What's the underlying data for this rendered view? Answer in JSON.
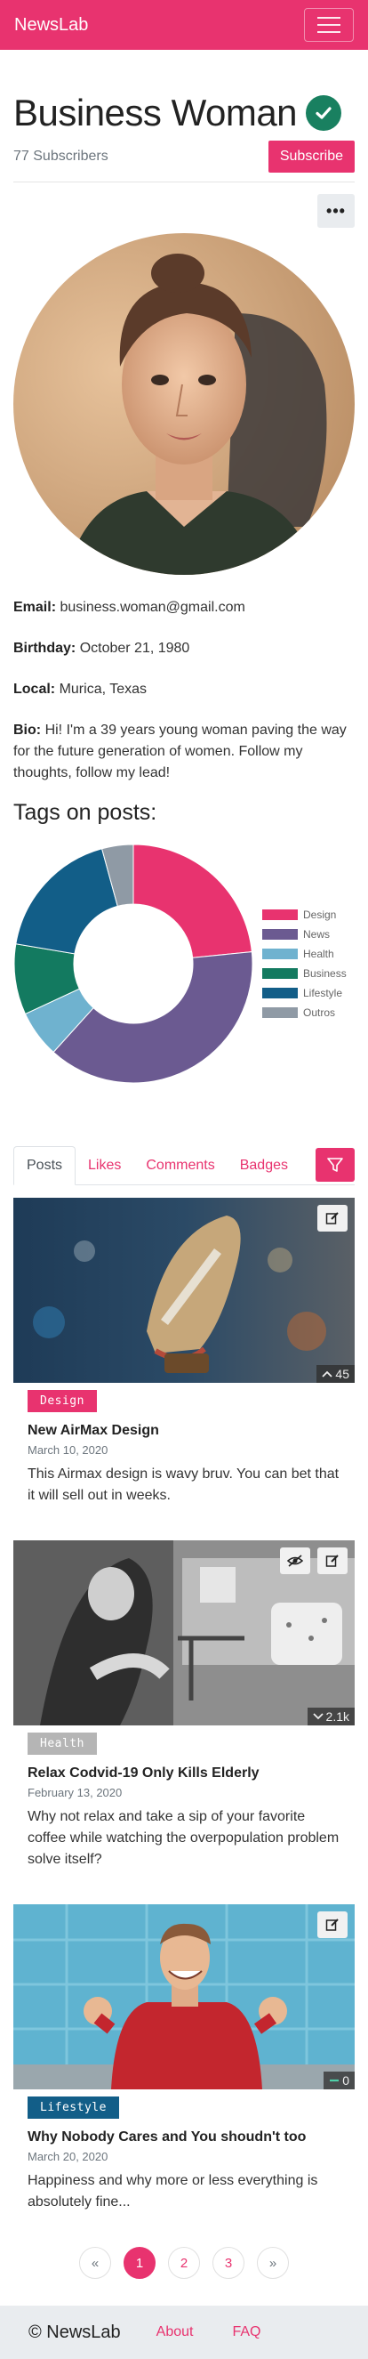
{
  "navbar": {
    "brand": "NewsLab"
  },
  "profile": {
    "name": "Business Woman",
    "subscribers": "77 Subscribers",
    "subscribe_label": "Subscribe",
    "more_label": "•••",
    "email_label": "Email:",
    "email": "business.woman@gmail.com",
    "birthday_label": "Birthday:",
    "birthday": "October 21, 1980",
    "local_label": "Local:",
    "local": "Murica, Texas",
    "bio_label": "Bio:",
    "bio": "Hi! I'm a 39 years young woman paving the way for the future generation of women. Follow my thoughts, follow my lead!"
  },
  "tags_title": "Tags on posts:",
  "chart_data": {
    "type": "pie",
    "title": "",
    "donut": true,
    "legend_position": "right",
    "categories": [
      "Design",
      "News",
      "Health",
      "Business",
      "Lifestyle",
      "Outros"
    ],
    "values": [
      22,
      36,
      6,
      9,
      17,
      4
    ],
    "colors": [
      "#e8336f",
      "#6b5a91",
      "#6fb2cf",
      "#137a60",
      "#125e88",
      "#8f9aa5"
    ]
  },
  "tabs": [
    "Posts",
    "Likes",
    "Comments",
    "Badges"
  ],
  "posts": [
    {
      "badge": "Design",
      "badge_color": "#e8336f",
      "title": "New AirMax Design",
      "date": "March 10, 2020",
      "text": "This Airmax design is wavy bruv. You can bet that it will sell out in weeks.",
      "stat": "45",
      "stat_icon": "chevron-up-icon"
    },
    {
      "badge": "Health",
      "badge_color": "#b5b5b5",
      "title": "Relax Codvid-19 Only Kills Elderly",
      "date": "February 13, 2020",
      "text": "Why not relax and take a sip of your favorite coffee while watching the overpopulation problem solve itself?",
      "stat": "2.1k",
      "stat_icon": "chevron-down-icon"
    },
    {
      "badge": "Lifestyle",
      "badge_color": "#125e88",
      "title": "Why Nobody Cares and You shoudn't too",
      "date": "March 20, 2020",
      "text": "Happiness and why more or less everything is absolutely fine...",
      "stat": "0",
      "stat_icon": "dash-icon"
    }
  ],
  "pagination": {
    "prev": "«",
    "pages": [
      "1",
      "2",
      "3"
    ],
    "next": "»",
    "active": "1"
  },
  "footer": {
    "copyright": "© NewsLab",
    "about": "About",
    "faq": "FAQ"
  }
}
